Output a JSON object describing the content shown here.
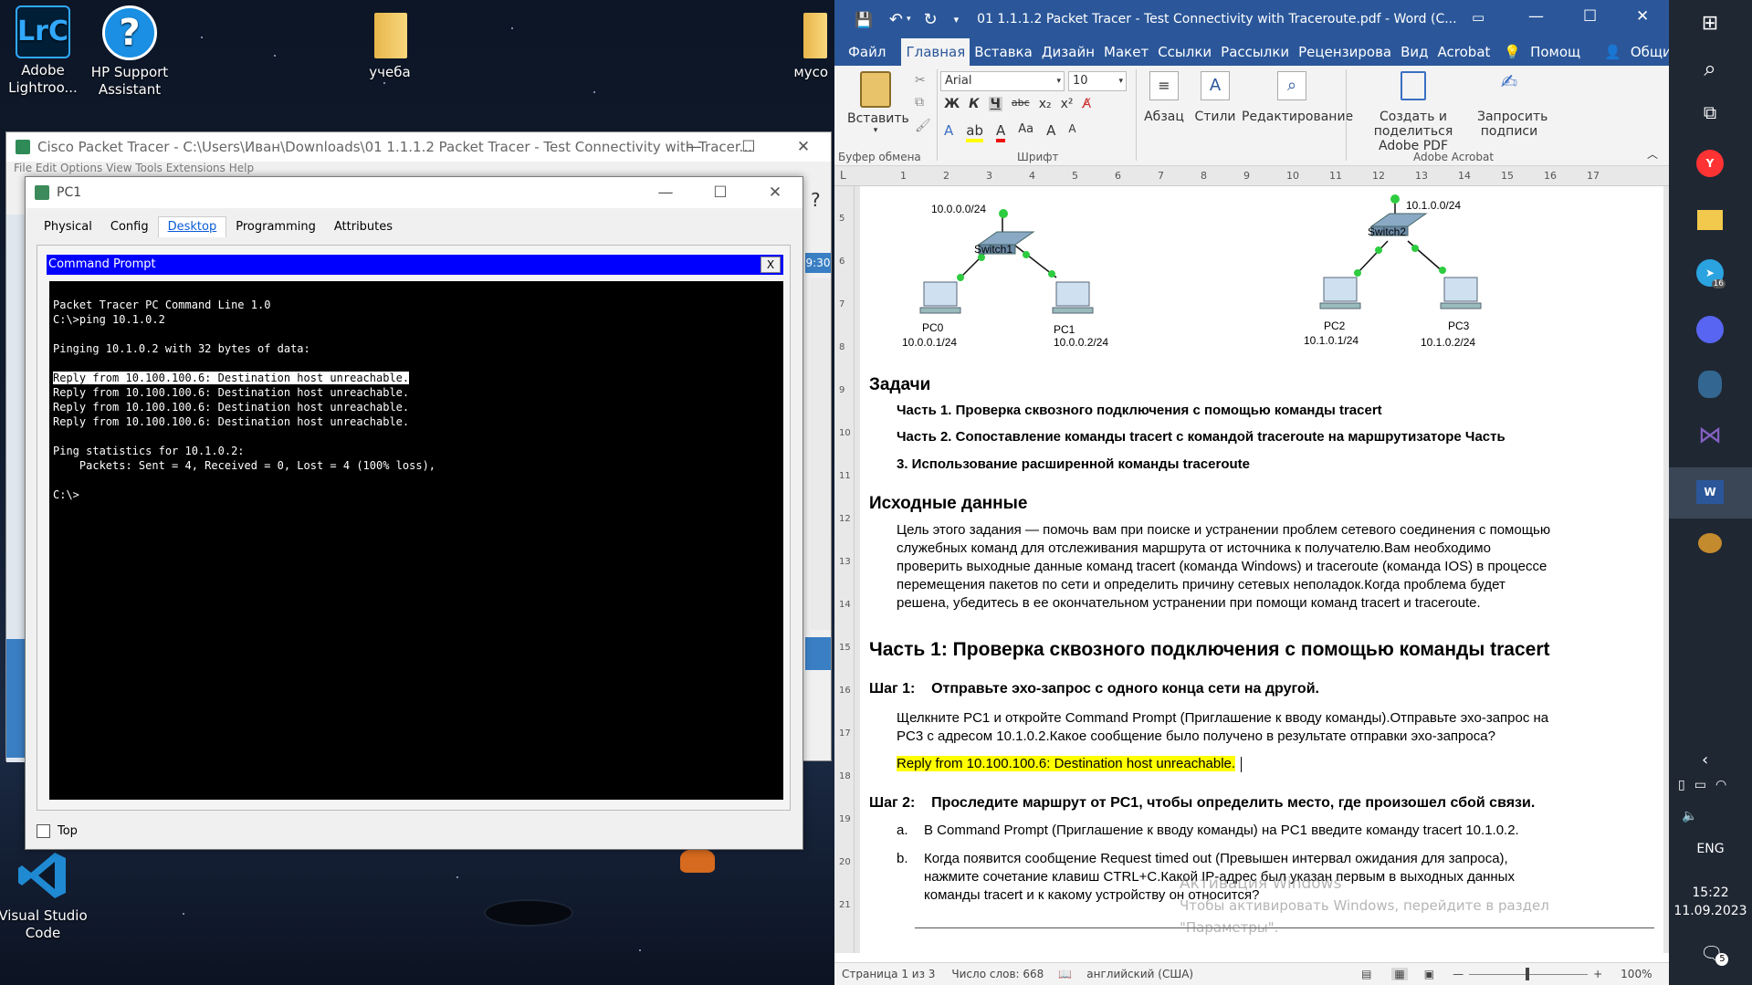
{
  "desktop": {
    "icons": [
      {
        "label_1": "Adobe",
        "label_2": "Lightroo...",
        "icon": "lightroom-icon"
      },
      {
        "label_1": "HP Support",
        "label_2": "Assistant",
        "icon": "hp-support-icon"
      },
      {
        "label_1": "учеба",
        "label_2": "",
        "icon": "folder-icon"
      },
      {
        "label_1": "мусо",
        "label_2": "",
        "icon": "folder-icon"
      },
      {
        "label_1": "Visual Studio",
        "label_2": "Code",
        "icon": "vscode-icon"
      }
    ]
  },
  "packet_tracer": {
    "title": "Cisco Packet Tracer - C:\\Users\\Иван\\Downloads\\01 1.1.1.2 Packet Tracer - Test Connectivity with Tracer...",
    "menu": "File   Edit   Options   View   Tools   Extensions   Help",
    "clock_fragment": "9:30"
  },
  "pc_window": {
    "title": "PC1",
    "tabs": [
      "Physical",
      "Config",
      "Desktop",
      "Programming",
      "Attributes"
    ],
    "active_tab": "Desktop",
    "cmd_title": "Command Prompt",
    "cmd_close": "X",
    "top_label": "Top",
    "console": {
      "line1": "Packet Tracer PC Command Line 1.0",
      "line2": "C:\\>ping 10.1.0.2",
      "line3": "Pinging 10.1.0.2 with 32 bytes of data:",
      "reply1": "Reply from 10.100.100.6: Destination host unreachable.",
      "reply2": "Reply from 10.100.100.6: Destination host unreachable.",
      "reply3": "Reply from 10.100.100.6: Destination host unreachable.",
      "reply4": "Reply from 10.100.100.6: Destination host unreachable.",
      "stats1": "Ping statistics for 10.1.0.2:",
      "stats2": "    Packets: Sent = 4, Received = 0, Lost = 4 (100% loss),",
      "prompt": "C:\\>"
    }
  },
  "word": {
    "title": "01 1.1.1.2 Packet Tracer - Test Connectivity with Traceroute.pdf - Word (C...",
    "tabs": [
      "Файл",
      "Главная",
      "Вставка",
      "Дизайн",
      "Макет",
      "Ссылки",
      "Рассылки",
      "Рецензирова",
      "Вид",
      "Acrobat"
    ],
    "active_tab": "Главная",
    "help": "Помощ",
    "share": "Общий доступ",
    "ribbon": {
      "paste": "Вставить",
      "clipboard_group": "Буфер обмена",
      "font_name": "Arial",
      "font_size": "10",
      "font_group": "Шрифт",
      "bold": "Ж",
      "italic": "К",
      "underline": "Ч",
      "strike": "abc",
      "paragraph": "Абзац",
      "styles": "Стили",
      "editing": "Редактирование",
      "create_pdf_1": "Создать и поделиться",
      "create_pdf_2": "Adobe PDF",
      "sign_1": "Запросить",
      "sign_2": "подписи",
      "acrobat_group": "Adobe Acrobat"
    },
    "ruler_numbers": [
      "1",
      "2",
      "3",
      "4",
      "5",
      "6",
      "7",
      "8",
      "9",
      "10",
      "11",
      "12",
      "13",
      "14",
      "15",
      "16",
      "17"
    ],
    "vruler_numbers": [
      "5",
      "6",
      "7",
      "8",
      "9",
      "10",
      "11",
      "12",
      "13",
      "14",
      "15",
      "16",
      "17",
      "18",
      "19",
      "20",
      "21"
    ],
    "diagram": {
      "net_left": "10.0.0.0/24",
      "net_right": "10.1.0.0/24",
      "switch1": "Switch1",
      "switch2": "Switch2",
      "pc0": "PC0",
      "pc0_ip": "10.0.0.1/24",
      "pc1": "PC1",
      "pc1_ip": "10.0.0.2/24",
      "pc2": "PC2",
      "pc2_ip": "10.1.0.1/24",
      "pc3": "PC3",
      "pc3_ip": "10.1.0.2/24"
    },
    "doc": {
      "h_tasks": "Задачи",
      "task1": "Часть 1. Проверка сквозного подключения с помощью команды tracert",
      "task2": "Часть 2. Сопоставление команды tracert с командой traceroute на маршрутизаторе Часть",
      "task3": "3. Использование расширенной команды traceroute",
      "h_source": "Исходные данные",
      "source_1": "Цель этого задания — помочь вам при поиске и устранении проблем сетевого соединения с помощью",
      "source_2": "служебных команд для отслеживания маршрута от источника к получателю.Вам необходимо",
      "source_3": "проверить выходные данные команд tracert (команда Windows) и traceroute (команда IOS) в процессе",
      "source_4": "перемещения пакетов по сети и определить причину сетевых неполадок.Когда проблема будет",
      "source_5": "решена, убедитесь в ее окончательном устранении при помощи команд tracert и traceroute.",
      "h_part1": "Часть 1: Проверка сквозного подключения с помощью команды tracert",
      "step1": "Шаг 1:    Отправьте эхо-запрос с одного конца сети на другой.",
      "step1_text_1": "Щелкните PC1 и откройте Command Prompt (Приглашение к вводу команды).Отправьте эхо-запрос на",
      "step1_text_2": "PC3 с адресом 10.1.0.2.Какое сообщение было получено в результате отправки эхо-запроса?",
      "answer": "Reply from 10.100.100.6: Destination host unreachable.",
      "step2": "Шаг 2:    Проследите маршрут от PC1, чтобы определить место, где произошел сбой связи.",
      "item_a_label": "a.",
      "item_a": "В Command Prompt (Приглашение к вводу команды) на PC1 введите команду tracert 10.1.0.2.",
      "item_b_label": "b.",
      "item_b_1": "Когда появится сообщение Request timed out (Превышен интервал ожидания для запроса),",
      "item_b_2": "нажмите сочетание клавиш CTRL+C.Какой IP-адрес был указан первым в выходных данных",
      "item_b_3": "команды tracert и к какому устройству он относится?",
      "watermark_1": "Активация Windows",
      "watermark_2": "Чтобы активировать Windows, перейдите в раздел",
      "watermark_3": "\"Параметры\"."
    },
    "status": {
      "page": "Страница 1 из 3",
      "words": "Число слов: 668",
      "lang": "английский (США)",
      "zoom": "100%"
    }
  },
  "taskbar": {
    "lang": "ENG",
    "time": "15:22",
    "date": "11.09.2023",
    "notif_count": "5",
    "telegram_badge": "16"
  }
}
